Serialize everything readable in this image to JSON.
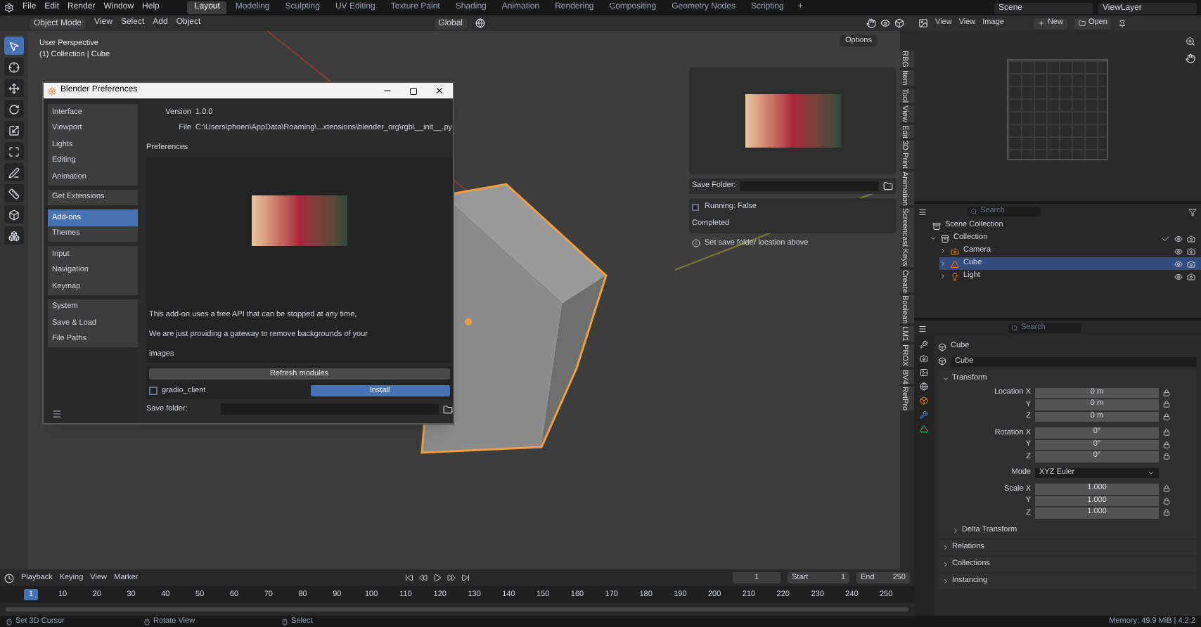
{
  "menubar": {
    "menus": [
      "File",
      "Edit",
      "Render",
      "Window",
      "Help"
    ],
    "workspaces": [
      {
        "label": "Layout",
        "selected": true
      },
      {
        "label": "Modeling",
        "selected": false
      },
      {
        "label": "Sculpting",
        "selected": false
      },
      {
        "label": "UV Editing",
        "selected": false
      },
      {
        "label": "Texture Paint",
        "selected": false
      },
      {
        "label": "Shading",
        "selected": false
      },
      {
        "label": "Animation",
        "selected": false
      },
      {
        "label": "Rendering",
        "selected": false
      },
      {
        "label": "Compositing",
        "selected": false
      },
      {
        "label": "Geometry Nodes",
        "selected": false
      },
      {
        "label": "Scripting",
        "selected": false
      }
    ],
    "add_tab": "+",
    "scene": "Scene",
    "view_layer": "ViewLayer"
  },
  "viewport": {
    "header": {
      "mode": "Object Mode",
      "menus": [
        "View",
        "Select",
        "Add",
        "Object"
      ],
      "orientation": "Global",
      "options": "Options"
    },
    "tools": [
      {
        "kind": "select",
        "selected": true
      },
      {
        "kind": "cursor",
        "selected": false
      },
      {
        "kind": "move",
        "selected": false
      },
      {
        "kind": "rotate",
        "selected": false
      },
      {
        "kind": "scale",
        "selected": false
      },
      {
        "kind": "transform",
        "selected": false
      },
      {
        "kind": "annotate",
        "selected": false
      },
      {
        "kind": "measure",
        "selected": false
      },
      {
        "kind": "add_cube",
        "selected": false
      },
      {
        "kind": "extrude",
        "selected": false
      }
    ],
    "overlay_text": [
      "User Perspective",
      "(1) Collection | Cube"
    ],
    "sidebar_tabs": [
      "RBG",
      "Item",
      "Tool",
      "View",
      "Edit",
      "3D Print",
      "Animation",
      "Screencast Keys",
      "Create",
      "Boolean",
      "LM1",
      "PROX",
      "BV4",
      "RetPro"
    ],
    "addon_panel": {
      "save_folder_label": "Save Folder:",
      "running": {
        "label": "Running: False",
        "checked": false
      },
      "status": "Completed",
      "hint": "Set save folder location above"
    }
  },
  "preferences": {
    "title": "Blender Preferences",
    "categories": [
      [
        {
          "label": "Interface",
          "selected": false
        },
        {
          "label": "Viewport",
          "selected": false
        },
        {
          "label": "Lights",
          "selected": false
        },
        {
          "label": "Editing",
          "selected": false
        },
        {
          "label": "Animation",
          "selected": false
        }
      ],
      [
        {
          "label": "Get Extensions",
          "selected": false
        }
      ],
      [
        {
          "label": "Add-ons",
          "selected": true
        },
        {
          "label": "Themes",
          "selected": false
        }
      ],
      [
        {
          "label": "Input",
          "selected": false
        },
        {
          "label": "Navigation",
          "selected": false
        },
        {
          "label": "Keymap",
          "selected": false
        }
      ],
      [
        {
          "label": "System",
          "selected": false
        },
        {
          "label": "Save & Load",
          "selected": false
        },
        {
          "label": "File Paths",
          "selected": false
        }
      ]
    ],
    "info": [
      {
        "label": "Version",
        "value": "1.0.0"
      },
      {
        "label": "File",
        "value": "C:\\Users\\phoen\\AppData\\Roaming\\...xtensions\\blender_org\\rgb\\__init__.py"
      }
    ],
    "section": "Preferences",
    "description": [
      "This add-on uses a free API that can be stopped at any time,",
      "We are just providing a gateway to remove backgrounds of your",
      "images"
    ],
    "refresh_button": "Refresh modules",
    "module": {
      "name": "gradio_client",
      "checked": false
    },
    "install_button": "Install",
    "save_folder_label": "Save folder:"
  },
  "image_editor": {
    "header": {
      "mode": "View",
      "menus": [
        "View",
        "Image"
      ],
      "new": "New",
      "open": "Open"
    }
  },
  "outliner": {
    "search_placeholder": "Search",
    "tree": [
      {
        "label": "Scene Collection",
        "kind": "scene",
        "selected": false,
        "children": [
          {
            "label": "Collection",
            "kind": "collection",
            "selected": false,
            "included": true,
            "children": [
              {
                "label": "Camera",
                "kind": "camera",
                "selected": false
              },
              {
                "label": "Cube",
                "kind": "mesh",
                "selected": true
              },
              {
                "label": "Light",
                "kind": "light",
                "selected": false
              }
            ]
          }
        ]
      }
    ]
  },
  "properties": {
    "search_placeholder": "Search",
    "object_title": "Cube",
    "object_name": "Cube",
    "transform": {
      "label": "Transform",
      "expanded": true,
      "rows": [
        {
          "label": "Location X",
          "value": "0 m",
          "kind": "number"
        },
        {
          "label": "Y",
          "value": "0 m",
          "kind": "number"
        },
        {
          "label": "Z",
          "value": "0 m",
          "kind": "number"
        },
        {
          "label": "Rotation X",
          "value": "0°",
          "kind": "number"
        },
        {
          "label": "Y",
          "value": "0°",
          "kind": "number"
        },
        {
          "label": "Z",
          "value": "0°",
          "kind": "number"
        },
        {
          "label": "Mode",
          "value": "XYZ Euler",
          "kind": "dropdown"
        },
        {
          "label": "Scale X",
          "value": "1.000",
          "kind": "number"
        },
        {
          "label": "Y",
          "value": "1.000",
          "kind": "number"
        },
        {
          "label": "Z",
          "value": "1.000",
          "kind": "number"
        }
      ],
      "subpanels": [
        {
          "label": "Delta Transform",
          "expanded": false
        }
      ]
    },
    "panels": [
      {
        "label": "Relations",
        "expanded": false
      },
      {
        "label": "Collections",
        "expanded": false
      },
      {
        "label": "Instancing",
        "expanded": false
      }
    ]
  },
  "timeline": {
    "menus": [
      "Playback",
      "Keying",
      "View",
      "Marker"
    ],
    "current_frame": "1",
    "start_label": "Start",
    "start": "1",
    "end_label": "End",
    "end": "250",
    "marker": "1",
    "ticks": [
      "10",
      "20",
      "30",
      "40",
      "50",
      "60",
      "70",
      "80",
      "90",
      "100",
      "110",
      "120",
      "130",
      "140",
      "150",
      "160",
      "170",
      "180",
      "190",
      "200",
      "210",
      "220",
      "230",
      "240",
      "250"
    ]
  },
  "status_bar": {
    "hints": [
      "Set 3D Cursor",
      "Rotate View",
      "Select"
    ],
    "memory": "Memory: 49.9 MiB | 4.2.2"
  }
}
